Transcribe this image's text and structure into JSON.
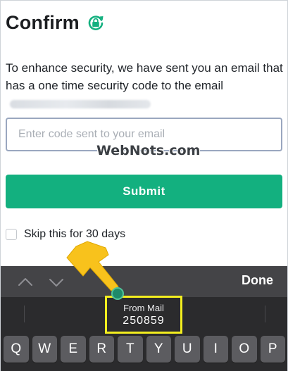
{
  "header": {
    "title": "Confirm",
    "icon": "lock-refresh-icon",
    "accent": "#13b07f"
  },
  "body": {
    "description": "To enhance security, we have sent you an email that has a one time security code to the email",
    "code_input": {
      "placeholder": "Enter code sent to your email",
      "value": ""
    },
    "submit_label": "Submit",
    "skip_label": "Skip this for 30 days",
    "skip_checked": false
  },
  "watermark": "WebNots.com",
  "keyboard": {
    "accessory": {
      "up_icon": "chevron-up-icon",
      "down_icon": "chevron-down-icon",
      "done_label": "Done"
    },
    "suggestion": {
      "source": "From Mail",
      "code": "250859"
    },
    "row1": [
      "Q",
      "W",
      "E",
      "R",
      "T",
      "Y",
      "U",
      "I",
      "O",
      "P"
    ]
  },
  "colors": {
    "submit": "#13b07f",
    "highlight": "#f3ee1f",
    "arrow": "#f8c21c",
    "keyboard": "#2b2b2d"
  }
}
